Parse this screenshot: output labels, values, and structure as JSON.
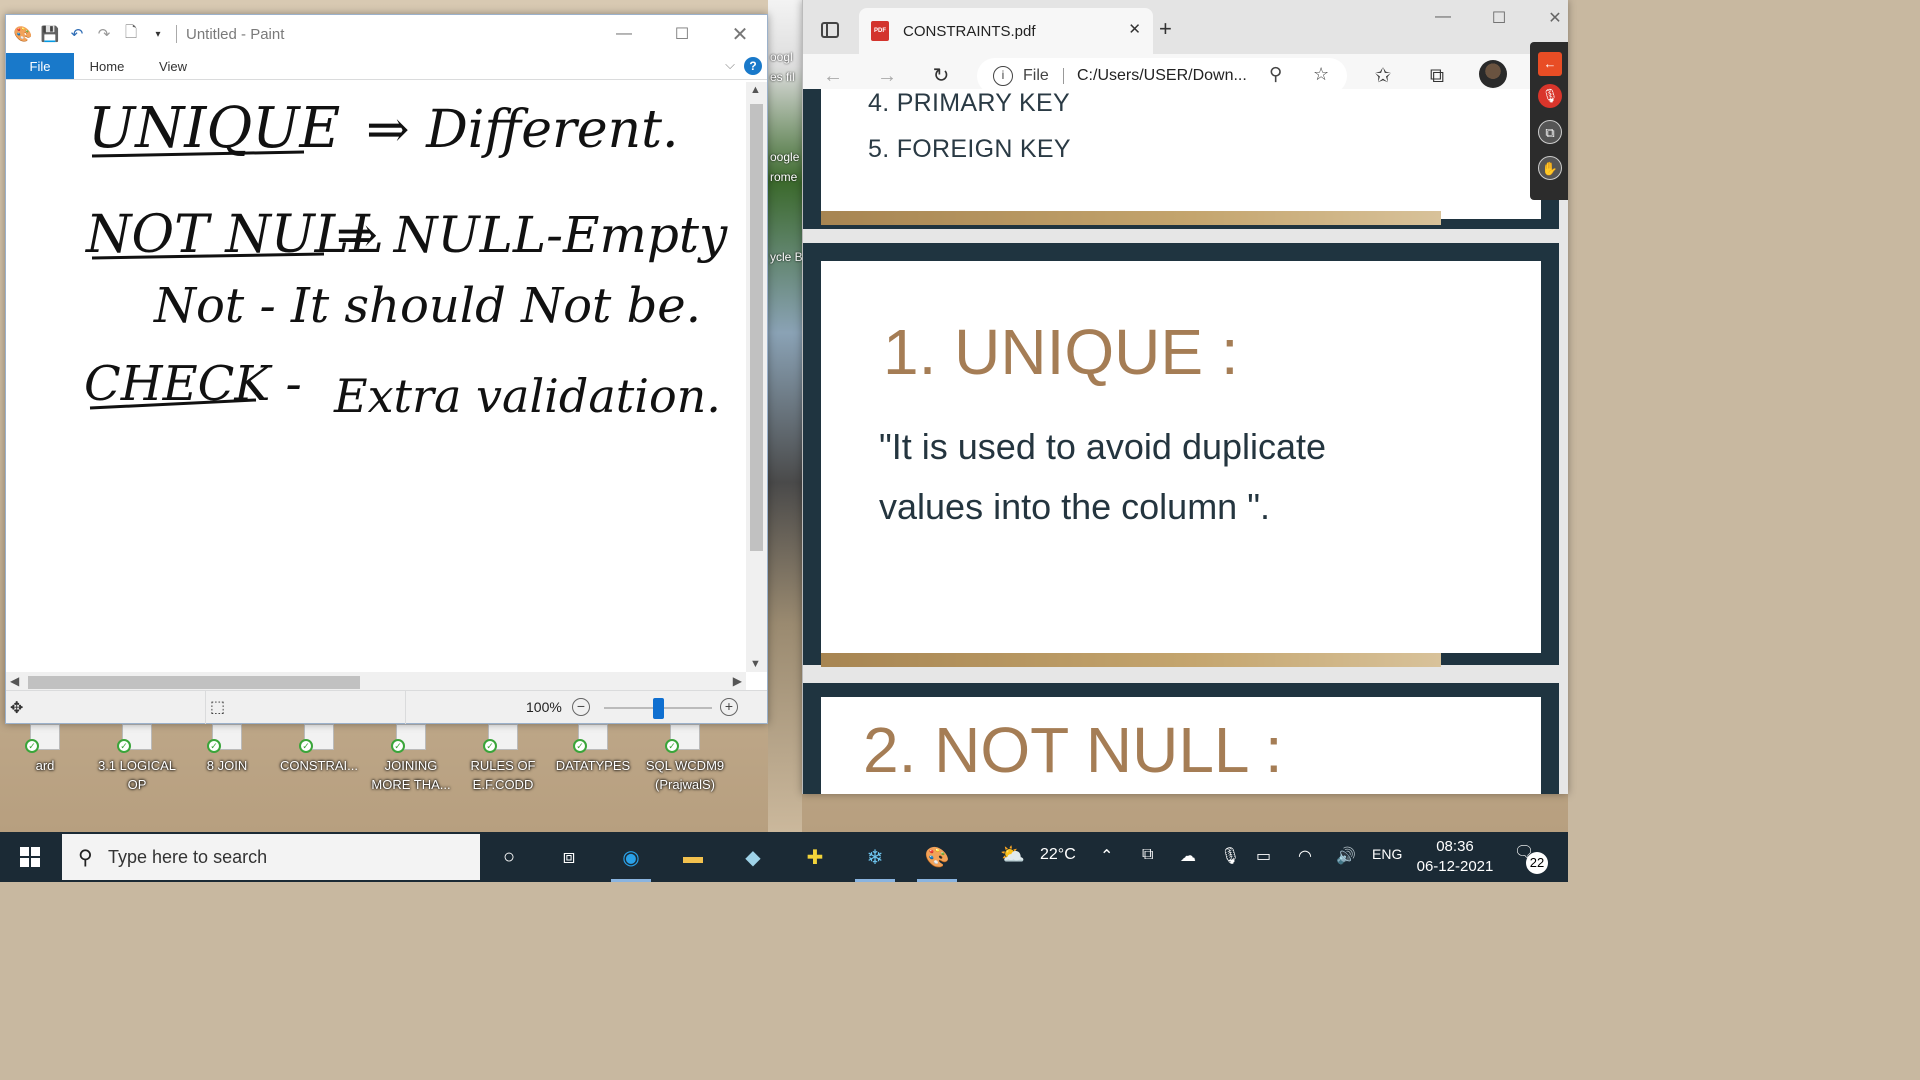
{
  "desktop": {
    "strip_labels": [
      "oogl",
      "es fil",
      "oogle",
      "rome",
      "ycle B"
    ],
    "icons": [
      {
        "label": "ard"
      },
      {
        "label": "3.1 LOGICAL OP"
      },
      {
        "label": "8 JOIN"
      },
      {
        "label": "CONSTRAI..."
      },
      {
        "label": "JOINING MORE THA..."
      },
      {
        "label": "RULES OF E.F.CODD"
      },
      {
        "label": "DATATYPES"
      },
      {
        "label": "SQL WCDM9 (PrajwalS)"
      }
    ]
  },
  "paint": {
    "title": "Untitled - Paint",
    "tabs": {
      "file": "File",
      "home": "Home",
      "view": "View"
    },
    "help": "?",
    "zoom": "100%",
    "zoom_level": 0.5,
    "handwriting": {
      "line1_a": "UNIQUE",
      "line1_b": "⇒ Different.",
      "line2_a": "NOT NULL",
      "line2_b": "⇒ NULL-Empty",
      "line3": "Not - It should Not be.",
      "line4_a": "CHECK -",
      "line4_b": "Extra validation."
    }
  },
  "browser": {
    "tab_title": "CONSTRAINTS.pdf",
    "address_label": "File",
    "url": "C:/Users/USER/Down...",
    "pdf_icon_text": "PDF"
  },
  "pdf": {
    "slide1_items": [
      "4. PRIMARY KEY",
      "5. FOREIGN KEY"
    ],
    "slide2_heading": "1. UNIQUE :",
    "slide2_text_line1": "\"It is used to avoid duplicate",
    "slide2_text_line2": "values into the column \".",
    "slide3_heading": "2. NOT NULL :"
  },
  "taskbar": {
    "search_placeholder": "Type here to search",
    "weather": "22°C",
    "language": "ENG",
    "time": "08:36",
    "date": "06-12-2021",
    "notifications": "22"
  },
  "colors": {
    "accent": "#1979ca",
    "slide_dark": "#1f3440",
    "slide_heading": "#a57d55",
    "taskbar": "#1b2a35"
  }
}
